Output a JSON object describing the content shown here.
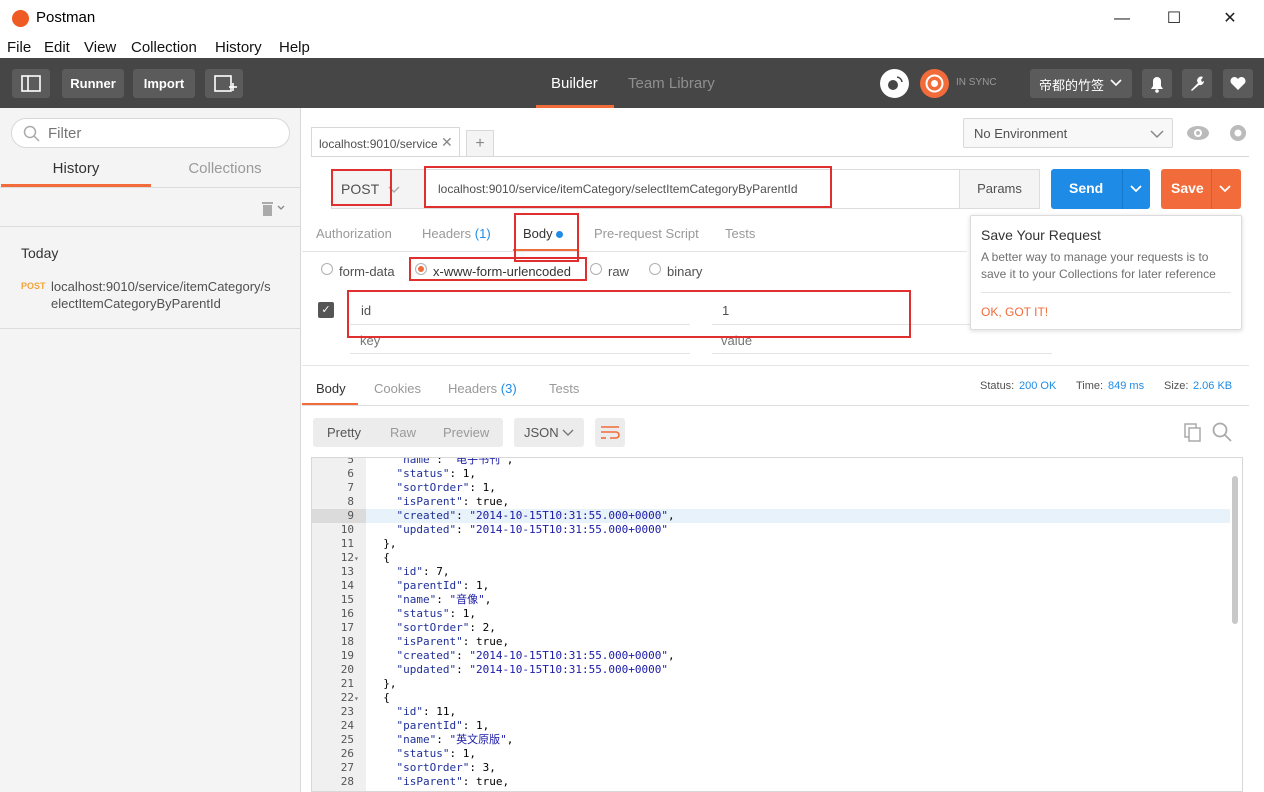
{
  "window": {
    "title": "Postman",
    "controls": [
      "—",
      "☐",
      "✕"
    ]
  },
  "menu": [
    "File",
    "Edit",
    "View",
    "Collection",
    "History",
    "Help"
  ],
  "header": {
    "runner": "Runner",
    "import": "Import",
    "tabs": [
      "Builder",
      "Team Library"
    ],
    "active_tab": "Builder",
    "sync_status": "IN SYNC",
    "user": "帝都的竹签"
  },
  "sidebar": {
    "filter_placeholder": "Filter",
    "tabs": [
      "History",
      "Collections"
    ],
    "active_tab": "History",
    "group_label": "Today",
    "history": [
      {
        "method": "POST",
        "url_line1": "localhost:9010/service/itemCategory/s",
        "url_line2": "electItemCategoryByParentId"
      }
    ]
  },
  "request": {
    "tab_title": "localhost:9010/service",
    "method": "POST",
    "url": "localhost:9010/service/itemCategory/selectItemCategoryByParentId",
    "params_label": "Params",
    "send_label": "Send",
    "save_label": "Save",
    "environment": "No Environment",
    "tabs": [
      {
        "label": "Authorization",
        "count": ""
      },
      {
        "label": "Headers",
        "count": "(1)"
      },
      {
        "label": "Body",
        "count": ""
      },
      {
        "label": "Pre-request Script",
        "count": ""
      },
      {
        "label": "Tests",
        "count": ""
      }
    ],
    "active_tab": "Body",
    "body_modes": [
      "form-data",
      "x-www-form-urlencoded",
      "raw",
      "binary"
    ],
    "selected_mode": "x-www-form-urlencoded",
    "params": [
      {
        "key": "id",
        "value": "1",
        "checked": true
      }
    ],
    "key_placeholder": "key",
    "value_placeholder": "value"
  },
  "tooltip": {
    "title": "Save Your Request",
    "text_line1": "A better way to manage your requests is to",
    "text_line2": "save it to your Collections for later reference",
    "action": "OK, GOT IT!"
  },
  "response": {
    "tabs": [
      {
        "label": "Body",
        "count": ""
      },
      {
        "label": "Cookies",
        "count": ""
      },
      {
        "label": "Headers",
        "count": "(3)"
      },
      {
        "label": "Tests",
        "count": ""
      }
    ],
    "active_tab": "Body",
    "status_label": "Status:",
    "status_value": "200 OK",
    "time_label": "Time:",
    "time_value": "849 ms",
    "size_label": "Size:",
    "size_value": "2.06 KB",
    "formats": [
      "Pretty",
      "Raw",
      "Preview"
    ],
    "active_format": "Pretty",
    "language": "JSON",
    "code": [
      {
        "n": "5",
        "fold": "",
        "text": "    \"name\": \"电子书刊\","
      },
      {
        "n": "6",
        "fold": "",
        "text": "    \"status\": 1,"
      },
      {
        "n": "7",
        "fold": "",
        "text": "    \"sortOrder\": 1,"
      },
      {
        "n": "8",
        "fold": "",
        "text": "    \"isParent\": true,"
      },
      {
        "n": "9",
        "fold": "",
        "text": "    \"created\": \"2014-10-15T10:31:55.000+0000\","
      },
      {
        "n": "10",
        "fold": "",
        "text": "    \"updated\": \"2014-10-15T10:31:55.000+0000\""
      },
      {
        "n": "11",
        "fold": "",
        "text": "  },"
      },
      {
        "n": "12",
        "fold": "▾",
        "text": "  {"
      },
      {
        "n": "13",
        "fold": "",
        "text": "    \"id\": 7,"
      },
      {
        "n": "14",
        "fold": "",
        "text": "    \"parentId\": 1,"
      },
      {
        "n": "15",
        "fold": "",
        "text": "    \"name\": \"音像\","
      },
      {
        "n": "16",
        "fold": "",
        "text": "    \"status\": 1,"
      },
      {
        "n": "17",
        "fold": "",
        "text": "    \"sortOrder\": 2,"
      },
      {
        "n": "18",
        "fold": "",
        "text": "    \"isParent\": true,"
      },
      {
        "n": "19",
        "fold": "",
        "text": "    \"created\": \"2014-10-15T10:31:55.000+0000\","
      },
      {
        "n": "20",
        "fold": "",
        "text": "    \"updated\": \"2014-10-15T10:31:55.000+0000\""
      },
      {
        "n": "21",
        "fold": "",
        "text": "  },"
      },
      {
        "n": "22",
        "fold": "▾",
        "text": "  {"
      },
      {
        "n": "23",
        "fold": "",
        "text": "    \"id\": 11,"
      },
      {
        "n": "24",
        "fold": "",
        "text": "    \"parentId\": 1,"
      },
      {
        "n": "25",
        "fold": "",
        "text": "    \"name\": \"英文原版\","
      },
      {
        "n": "26",
        "fold": "",
        "text": "    \"status\": 1,"
      },
      {
        "n": "27",
        "fold": "",
        "text": "    \"sortOrder\": 3,"
      },
      {
        "n": "28",
        "fold": "",
        "text": "    \"isParent\": true,"
      }
    ],
    "highlighted_line": "9"
  },
  "colors": {
    "accent": "#f26b3a",
    "send": "#1e8ce6",
    "header_bg": "#464646",
    "annotation": "#e02f2f",
    "status_ok": "#1e8ce6"
  }
}
